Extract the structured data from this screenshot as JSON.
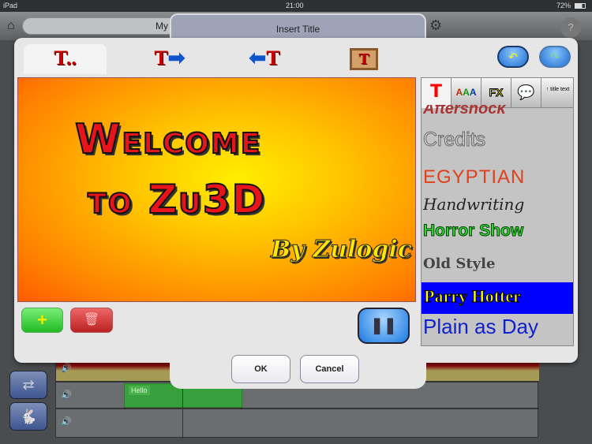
{
  "status_bar": {
    "device": "iPad",
    "time": "21:00",
    "battery": "72%"
  },
  "app_toolbar": {
    "project_title": "My"
  },
  "dialog": {
    "title": "Insert Title",
    "top_tabs": [
      {
        "label": "T..",
        "icon": "title-text-icon"
      },
      {
        "label": "T",
        "icon": "title-in-right-icon"
      },
      {
        "label": "T",
        "icon": "title-in-left-icon"
      },
      {
        "label": "T",
        "icon": "title-box-icon"
      }
    ],
    "undo_icon": "undo-icon",
    "redo_icon": "redo-icon",
    "preview": {
      "line1": "Welcome",
      "line2": "to Zu3D",
      "byline": "By Zulogic"
    },
    "font_tabs": [
      {
        "label": "T",
        "icon": "font-icon"
      },
      {
        "label": "AAA",
        "icon": "color-icon"
      },
      {
        "label": "FX",
        "icon": "fx-icon"
      },
      {
        "label": "",
        "icon": "speech-bubble-icon"
      },
      {
        "label": "title text",
        "icon": "position-icon"
      }
    ],
    "fonts": [
      {
        "name": "Aftershock"
      },
      {
        "name": "Credits"
      },
      {
        "name": "Egyptian"
      },
      {
        "name": "Handwriting"
      },
      {
        "name": "Horror Show"
      },
      {
        "name": "Old Style"
      },
      {
        "name": "Parry Hotter",
        "selected": true
      },
      {
        "name": "Plain as Day"
      }
    ],
    "ok_label": "OK",
    "cancel_label": "Cancel"
  },
  "timeline": {
    "clip_label": "Hello"
  },
  "colors": {
    "accent": "#1e6fd0",
    "selected_font_bg": "#0000ff"
  }
}
